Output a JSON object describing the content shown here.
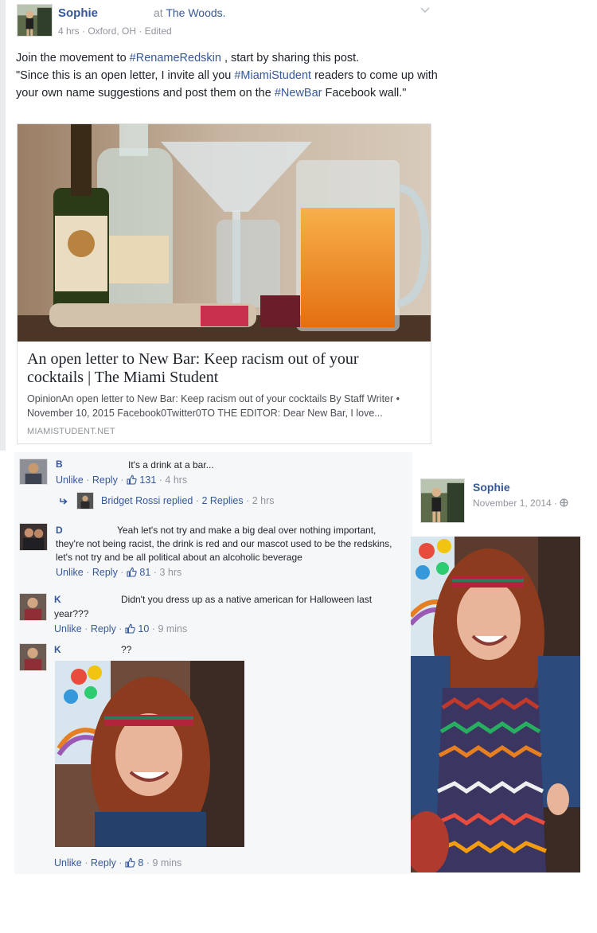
{
  "post": {
    "author": "Sophie",
    "location_prefix": "at",
    "location": "The Woods.",
    "meta": "4 hrs · Oxford, OH · Edited",
    "text": {
      "p1": "Join the movement to ",
      "tag1": "#RenameRedskin",
      "p2": " , start by sharing this post.",
      "p3": "\"Since this is an open letter, I invite all you ",
      "tag2": "#MiamiStudent",
      "p4": " readers to come up with your own name suggestions and post them on the ",
      "tag3": "#NewBar",
      "p5": " Facebook wall.\""
    },
    "link": {
      "title": "An open letter to New Bar: Keep racism out of your cocktails | The Miami Student",
      "description": "OpinionAn open letter to New Bar: Keep racism out of your cocktails By Staff Writer • November 10, 2015 Facebook0Twitter0TO THE EDITOR: Dear New Bar, I love...",
      "domain": "MIAMISTUDENT.NET"
    }
  },
  "comments": [
    {
      "author": "B",
      "text": "It's a drink at a bar...",
      "unlike": "Unlike",
      "reply": "Reply",
      "likes": "131",
      "time": "4 hrs",
      "replies": {
        "name": "Bridget Rossi",
        "replied": "replied",
        "count": "2 Replies",
        "time": "2 hrs"
      }
    },
    {
      "author": "D",
      "text_line1": "Yeah let's not try and make a big deal over nothing important,",
      "text_rest": "they're not being racist, the drink is red and our mascot used to be the redskins, let's not try and be all political about an alcoholic beverage",
      "unlike": "Unlike",
      "reply": "Reply",
      "likes": "81",
      "time": "3 hrs"
    },
    {
      "author": "K",
      "text_line1": "Didn't you dress up as a native american for Halloween last",
      "text_rest": "year???",
      "unlike": "Unlike",
      "reply": "Reply",
      "likes": "10",
      "time": "9 mins"
    },
    {
      "author": "K",
      "text": "??",
      "unlike": "Unlike",
      "reply": "Reply",
      "likes": "8",
      "time": "9 mins"
    }
  ],
  "side_post": {
    "author": "Sophie",
    "date": "November 1, 2014 ·"
  },
  "icons": {
    "chevron": "chevron-down-icon",
    "reply_arrow": "reply-arrow-icon",
    "like": "thumbs-up-icon",
    "globe": "globe-icon"
  },
  "colors": {
    "link": "#365899",
    "muted": "#90949c",
    "panel": "#f6f7f9"
  }
}
